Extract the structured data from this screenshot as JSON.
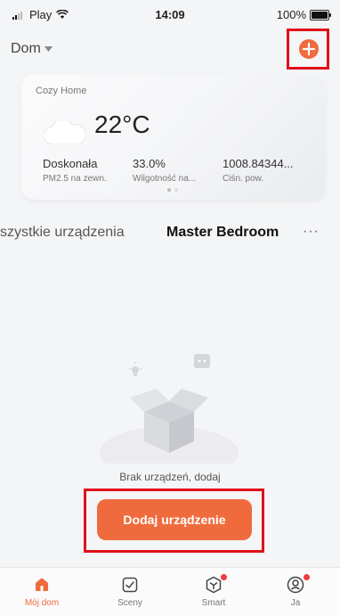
{
  "status_bar": {
    "carrier": "Play",
    "time": "14:09",
    "battery": "100%"
  },
  "header": {
    "home_name": "Dom"
  },
  "weather": {
    "home_label": "Cozy Home",
    "temperature": "22°C",
    "stats": [
      {
        "value": "Doskonała",
        "label": "PM2.5 na zewn."
      },
      {
        "value": "33.0%",
        "label": "Wilgotność na..."
      },
      {
        "value": "1008.84344...",
        "label": "Ciśn. pow."
      }
    ]
  },
  "rooms": {
    "all_tab": "szystkie urządzenia",
    "active_tab": "Master Bedroom",
    "more": "···"
  },
  "empty_state": {
    "message": "Brak urządzeń, dodaj",
    "button_label": "Dodaj urządzenie"
  },
  "nav": {
    "items": [
      {
        "label": "Mój dom"
      },
      {
        "label": "Sceny"
      },
      {
        "label": "Smart"
      },
      {
        "label": "Ja"
      }
    ]
  },
  "colors": {
    "accent": "#ef6b3e",
    "highlight": "#e0101a"
  }
}
